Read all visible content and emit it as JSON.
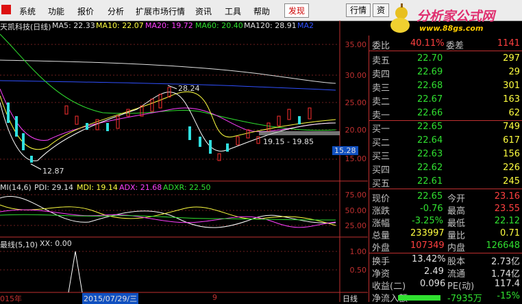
{
  "menu": {
    "system": "系统",
    "function": "功能",
    "quote": "报价",
    "analysis": "分析",
    "ext_market": "扩展市场行情",
    "news": "资讯",
    "tools": "工具",
    "help": "帮助",
    "discover": "发现",
    "market_btn": "行情",
    "info_btn": "资"
  },
  "brand": {
    "title": "分析家公式网",
    "url": "www.88gs.com"
  },
  "main_chart": {
    "title": "天凯科技(日线)",
    "ma5": "MA5: 22.33",
    "ma10": "MA10: 22.07",
    "ma20": "MA20: 19.72",
    "ma60": "MA60: 20.40",
    "ma120": "MA120: 28.91",
    "ma2": "MA2",
    "high_label": "28.24",
    "low_label": "12.87",
    "range_label": "19.15 - 19.85",
    "price_tag": "15.28",
    "yticks": [
      "35.00",
      "30.00",
      "25.00",
      "20.00",
      "15.00"
    ]
  },
  "dmi_chart": {
    "title": "MI(14,6)",
    "pdi": "PDI: 29.14",
    "mdi": "MDI: 19.14",
    "adx": "ADX: 21.68",
    "adxr": "ADXR: 22.50",
    "yticks": [
      "75.00",
      "50.00",
      "25.00"
    ]
  },
  "xx_chart": {
    "title": "最线(5,10)",
    "xx": "XX: 0.00",
    "yticks": [
      "1.00",
      "0.50"
    ]
  },
  "xaxis": {
    "year": "015年",
    "date": "2015/07/29/三",
    "nine": "9",
    "period": "日线"
  },
  "quote": {
    "weibi_label": "委比",
    "weibi": "40.11%",
    "weicha_label": "委差",
    "weicha": "1141",
    "sell": [
      {
        "label": "卖五",
        "price": "22.70",
        "vol": "297"
      },
      {
        "label": "卖四",
        "price": "22.69",
        "vol": "29"
      },
      {
        "label": "卖三",
        "price": "22.68",
        "vol": "301"
      },
      {
        "label": "卖二",
        "price": "22.67",
        "vol": "163"
      },
      {
        "label": "卖一",
        "price": "22.66",
        "vol": "62"
      }
    ],
    "buy": [
      {
        "label": "买一",
        "price": "22.65",
        "vol": "749"
      },
      {
        "label": "买二",
        "price": "22.64",
        "vol": "617"
      },
      {
        "label": "买三",
        "price": "22.63",
        "vol": "156"
      },
      {
        "label": "买四",
        "price": "22.62",
        "vol": "226"
      },
      {
        "label": "买五",
        "price": "22.61",
        "vol": "245"
      }
    ],
    "stats": [
      {
        "l1": "现价",
        "v1": "22.65",
        "l2": "今开",
        "v2": "23.16"
      },
      {
        "l1": "涨跌",
        "v1": "-0.76",
        "l2": "最高",
        "v2": "23.55"
      },
      {
        "l1": "涨幅",
        "v1": "-3.25%",
        "l2": "最低",
        "v2": "22.12"
      },
      {
        "l1": "总量",
        "v1": "233997",
        "l2": "量比",
        "v2": "0.71"
      },
      {
        "l1": "外盘",
        "v1": "107349",
        "l2": "内盘",
        "v2": "126648"
      }
    ],
    "stats2": [
      {
        "l1": "换手",
        "v1": "13.42%",
        "l2": "股本",
        "v2": "2.73亿"
      },
      {
        "l1": "净资",
        "v1": "2.49",
        "l2": "流通",
        "v2": "1.74亿"
      },
      {
        "l1": "收益(二)",
        "v1": "0.096",
        "l2": "PE(动)",
        "v2": "117.4"
      }
    ],
    "netflow_label": "净流入额",
    "netflow_value": "-7935万",
    "netflow_pct": "-15%"
  },
  "colors": {
    "up": "#ff3030",
    "down": "#30e0e0",
    "ma5": "#ffffff",
    "ma10": "#ffff40",
    "ma20": "#ff40ff",
    "ma60": "#30e030",
    "ma120": "#e0e0e0",
    "ma2": "#3050ff"
  }
}
